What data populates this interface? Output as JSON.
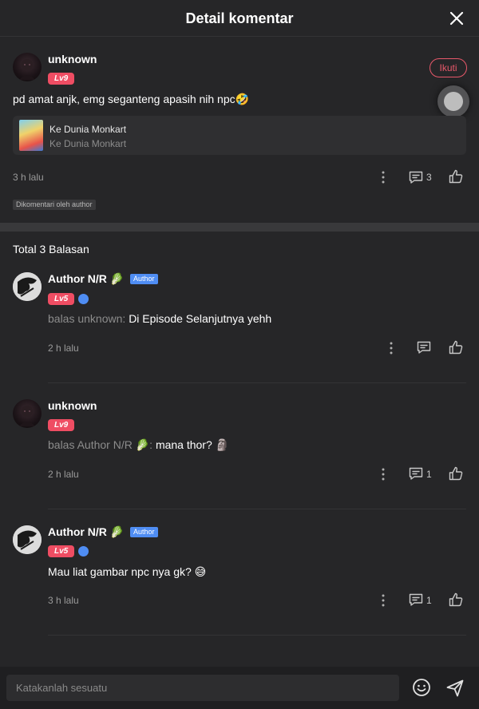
{
  "header": {
    "title": "Detail komentar"
  },
  "main_comment": {
    "username": "unknown",
    "level": "Lv9",
    "follow_label": "Ikuti",
    "text": "pd amat anjk, emg seganteng apasih nih npc🤣",
    "book": {
      "title": "Ke Dunia Monkart",
      "subtitle": "Ke Dunia Monkart"
    },
    "time": "3 h lalu",
    "reply_count": "3",
    "tag": "Dikomentari oleh author"
  },
  "replies_header": "Total 3 Balasan",
  "replies": [
    {
      "username": "Author N/R 🥬",
      "author_badge": "Author",
      "level": "Lv5",
      "prefix": "balas unknown: ",
      "text": "Di Episode Selanjutnya yehh",
      "time": "2 h lalu",
      "reply_count": ""
    },
    {
      "username": "unknown",
      "level": "Lv9",
      "prefix": "balas Author N/R 🥬: ",
      "text": "mana thor? 🗿",
      "time": "2 h lalu",
      "reply_count": "1"
    },
    {
      "username": "Author N/R 🥬",
      "author_badge": "Author",
      "level": "Lv5",
      "prefix": "",
      "text": "Mau liat gambar npc nya gk? 😅",
      "time": "3 h lalu",
      "reply_count": "1"
    }
  ],
  "composer": {
    "placeholder": "Katakanlah sesuatu"
  },
  "colors": {
    "background": "#262628",
    "accent": "#ef4d63",
    "author_badge": "#4f8df3"
  }
}
